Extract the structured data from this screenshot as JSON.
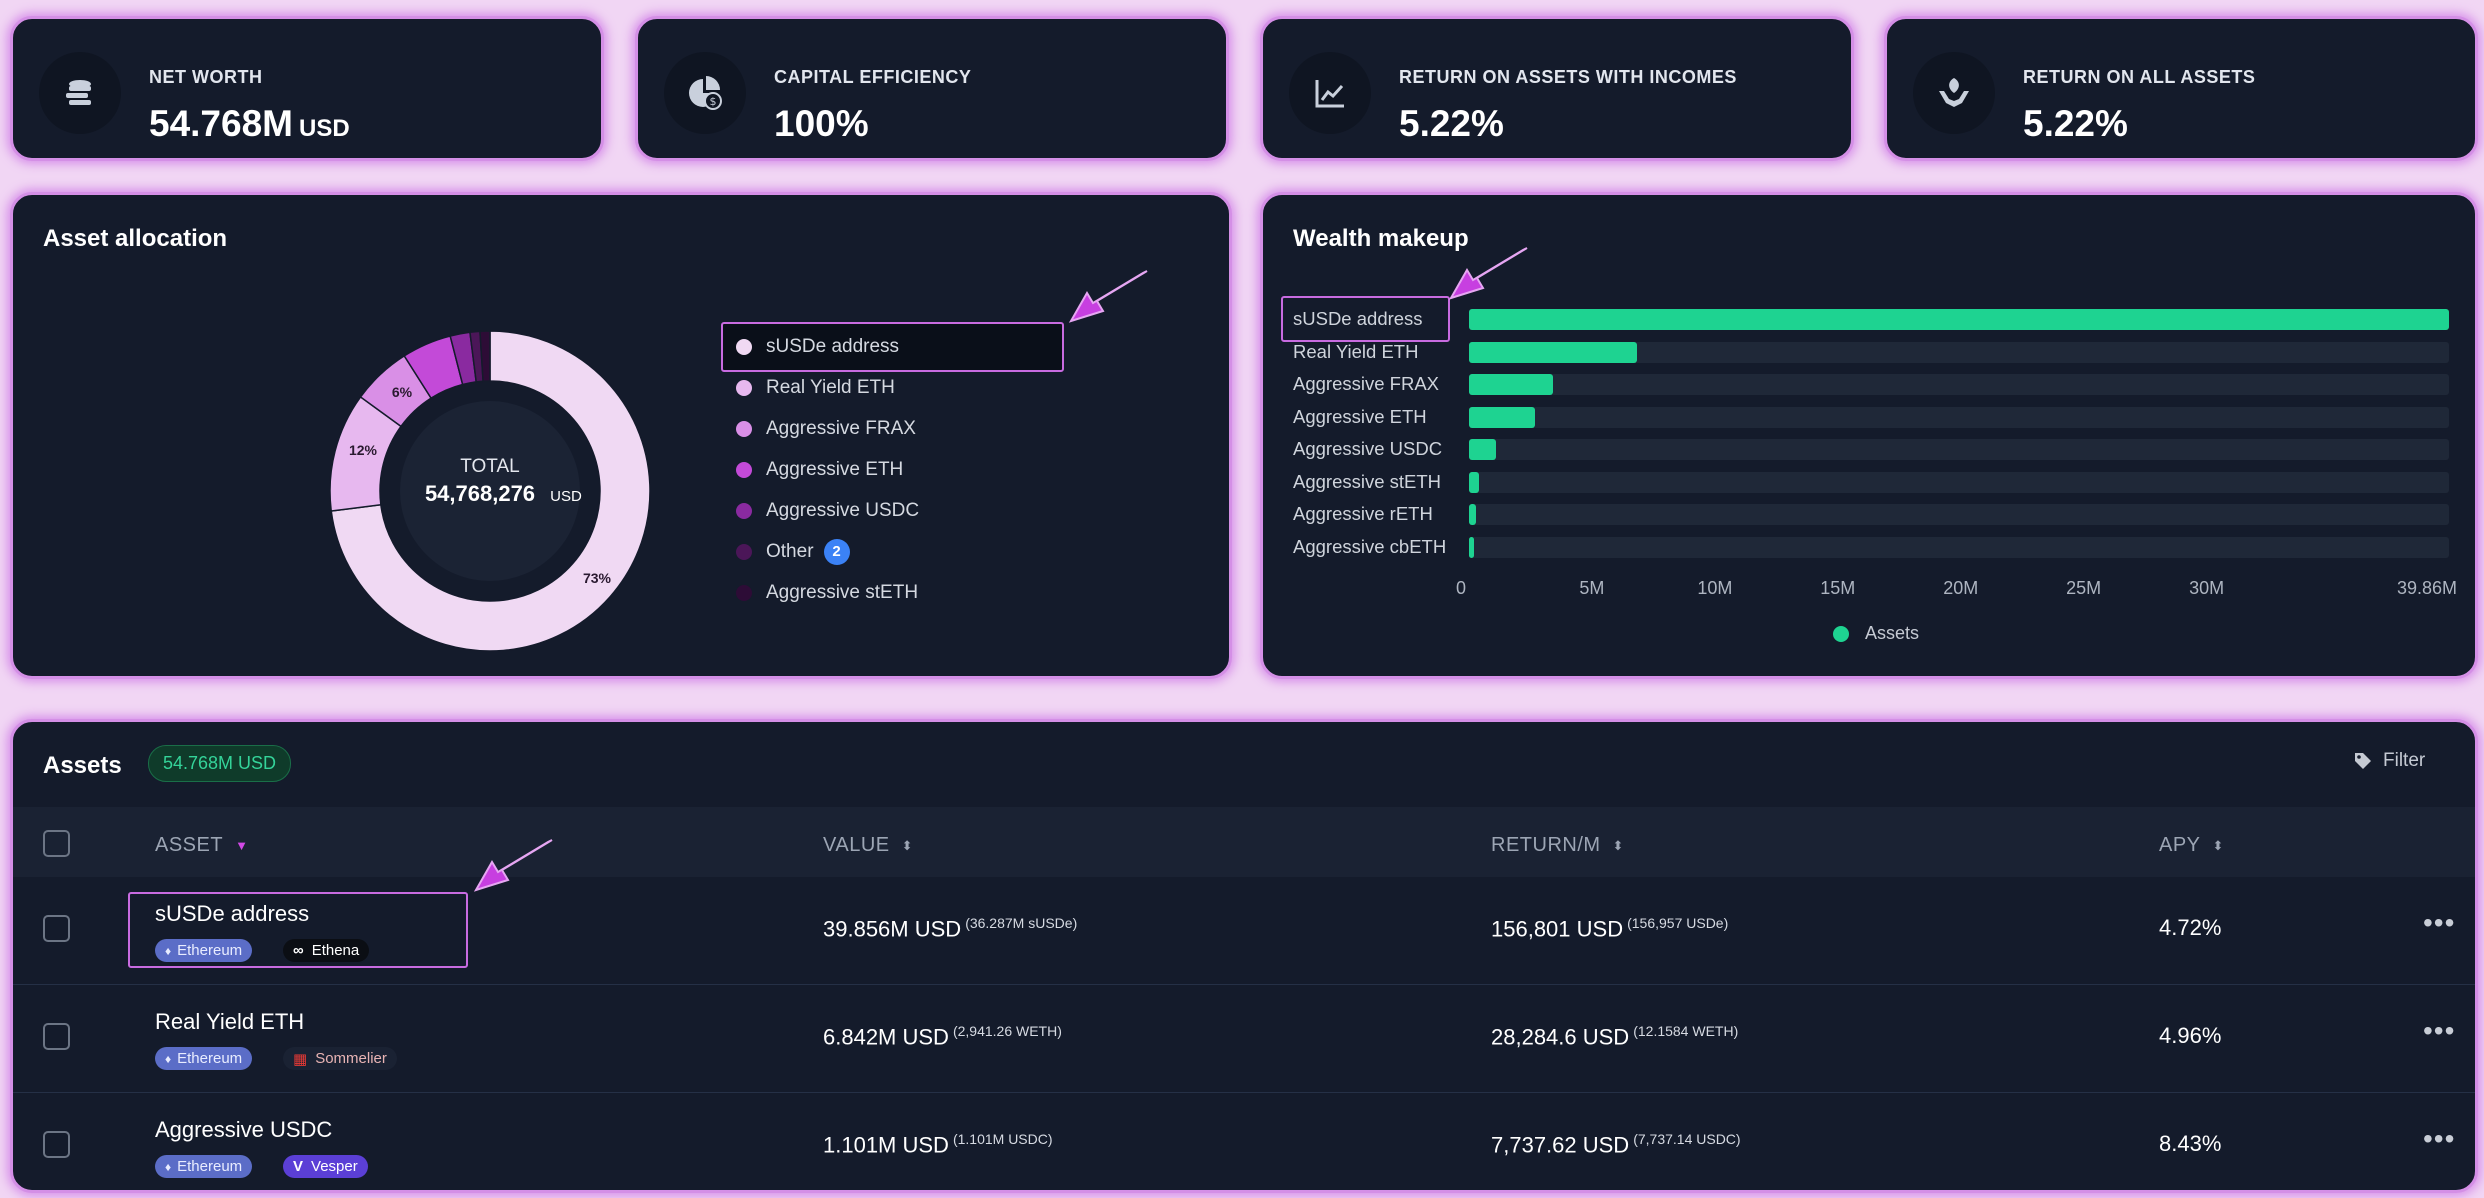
{
  "kpis": [
    {
      "label": "NET WORTH",
      "value": "54.768M",
      "unit": "USD",
      "icon": "coins-icon"
    },
    {
      "label": "CAPITAL EFFICIENCY",
      "value": "100%",
      "icon": "pie-chart-dollar-icon"
    },
    {
      "label": "RETURN ON ASSETS WITH INCOMES",
      "value": "5.22%",
      "icon": "line-chart-icon"
    },
    {
      "label": "RETURN ON ALL ASSETS",
      "value": "5.22%",
      "icon": "hands-plant-icon"
    }
  ],
  "allocation": {
    "title": "Asset allocation",
    "total_label": "TOTAL",
    "total_value": "54,768,276",
    "total_unit": "USD",
    "slice_labels": [
      "73%",
      "12%",
      "6%"
    ],
    "slices": [
      {
        "name": "sUSDe address",
        "percent": 73,
        "color": "#f0d9f3"
      },
      {
        "name": "Real Yield ETH",
        "percent": 12,
        "color": "#e7b8ef"
      },
      {
        "name": "Aggressive FRAX",
        "percent": 6,
        "color": "#d98fe6"
      },
      {
        "name": "Aggressive ETH",
        "percent": 5,
        "color": "#c34ad8"
      },
      {
        "name": "Aggressive USDC",
        "percent": 2,
        "color": "#8a2aa0"
      },
      {
        "name": "Other",
        "percent": 1,
        "color": "#4b1658"
      },
      {
        "name": "Aggressive stETH",
        "percent": 1,
        "color": "#2d0c36"
      }
    ],
    "legend": [
      {
        "label": "sUSDe address",
        "color": "#f0d9f3"
      },
      {
        "label": "Real Yield ETH",
        "color": "#e7b8ef"
      },
      {
        "label": "Aggressive FRAX",
        "color": "#d98fe6"
      },
      {
        "label": "Aggressive ETH",
        "color": "#c34ad8"
      },
      {
        "label": "Aggressive USDC",
        "color": "#8a2aa0"
      },
      {
        "label": "Other",
        "color": "#4b1658",
        "badge": "2"
      },
      {
        "label": "Aggressive stETH",
        "color": "#2d0c36"
      }
    ]
  },
  "wealth": {
    "title": "Wealth makeup",
    "legend_label": "Assets",
    "bar_color": "#1ed391",
    "axis_ticks": [
      "0",
      "5M",
      "10M",
      "15M",
      "20M",
      "25M",
      "30M",
      "39.86M"
    ]
  },
  "chart_data": {
    "type": "bar",
    "orientation": "horizontal",
    "title": "Wealth makeup",
    "categories": [
      "sUSDe address",
      "Real Yield ETH",
      "Aggressive FRAX",
      "Aggressive ETH",
      "Aggressive USDC",
      "Aggressive stETH",
      "Aggressive rETH",
      "Aggressive cbETH"
    ],
    "series": [
      {
        "name": "Assets",
        "values": [
          39.856,
          6.842,
          3.4,
          2.7,
          1.101,
          0.4,
          0.3,
          0.2
        ]
      }
    ],
    "xunit": "M",
    "xlim": [
      0,
      39.86
    ],
    "legend": "bottom"
  },
  "assets": {
    "title": "Assets",
    "total_badge": "54.768M USD",
    "filter_label": "Filter",
    "columns": {
      "asset": "ASSET",
      "value": "VALUE",
      "return": "RETURN/M",
      "apy": "APY"
    },
    "rows": [
      {
        "name": "sUSDe address",
        "chain": "Ethereum",
        "protocol": "Ethena",
        "value": "39.856M USD",
        "value_sub": "(36.287M sUSDe)",
        "ret": "156,801 USD",
        "ret_sub": "(156,957 USDe)",
        "apy": "4.72%"
      },
      {
        "name": "Real Yield ETH",
        "chain": "Ethereum",
        "protocol": "Sommelier",
        "value": "6.842M USD",
        "value_sub": "(2,941.26 WETH)",
        "ret": "28,284.6 USD",
        "ret_sub": "(12.1584 WETH)",
        "apy": "4.96%"
      },
      {
        "name": "Aggressive USDC",
        "chain": "Ethereum",
        "protocol": "Vesper",
        "value": "1.101M USD",
        "value_sub": "(1.101M USDC)",
        "ret": "7,737.62 USD",
        "ret_sub": "(7,737.14 USDC)",
        "apy": "8.43%"
      }
    ],
    "more_label": "•••"
  }
}
